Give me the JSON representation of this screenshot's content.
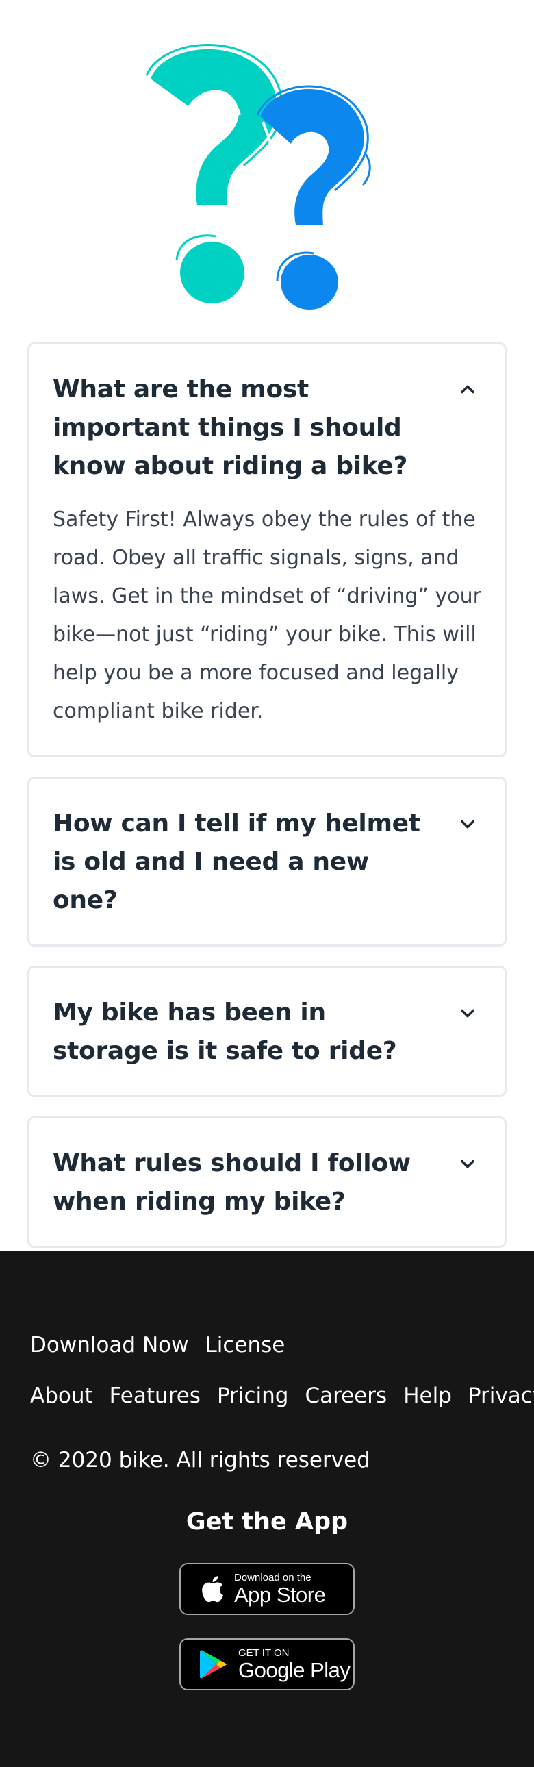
{
  "faq": [
    {
      "question": "What are the most important things I should know about riding a bike?",
      "answer": "Safety First! Always obey the rules of the road. Obey all traffic signals, signs, and laws. Get in the mindset of “driving” your bike—not just “riding” your bike. This will help you be a more focused and legally compliant bike rider.",
      "expanded": true
    },
    {
      "question": "How can I tell if my helmet is old and I need a new one?",
      "expanded": false
    },
    {
      "question": "My bike has been in storage is it safe to ride?",
      "expanded": false
    },
    {
      "question": "What rules should I follow when riding my bike?",
      "expanded": false
    }
  ],
  "footer": {
    "links_row1": [
      "Download Now",
      "License"
    ],
    "links_row2": [
      "About",
      "Features",
      "Pricing",
      "Careers",
      "Help",
      "Privacy"
    ],
    "copyright": "© 2020 bike. All rights reserved",
    "get_app_title": "Get the App",
    "app_store": {
      "small": "Download on the",
      "big": "App Store"
    },
    "google_play": {
      "small": "GET IT ON",
      "big": "Google Play"
    }
  },
  "colors": {
    "teal": "#00d1c3",
    "blue": "#0b87ee",
    "footer_bg": "#161616",
    "text": "#1f2a37"
  },
  "icons": [
    "question-marks-illustration",
    "chevron-up-icon",
    "chevron-down-icon",
    "apple-icon",
    "google-play-icon"
  ]
}
